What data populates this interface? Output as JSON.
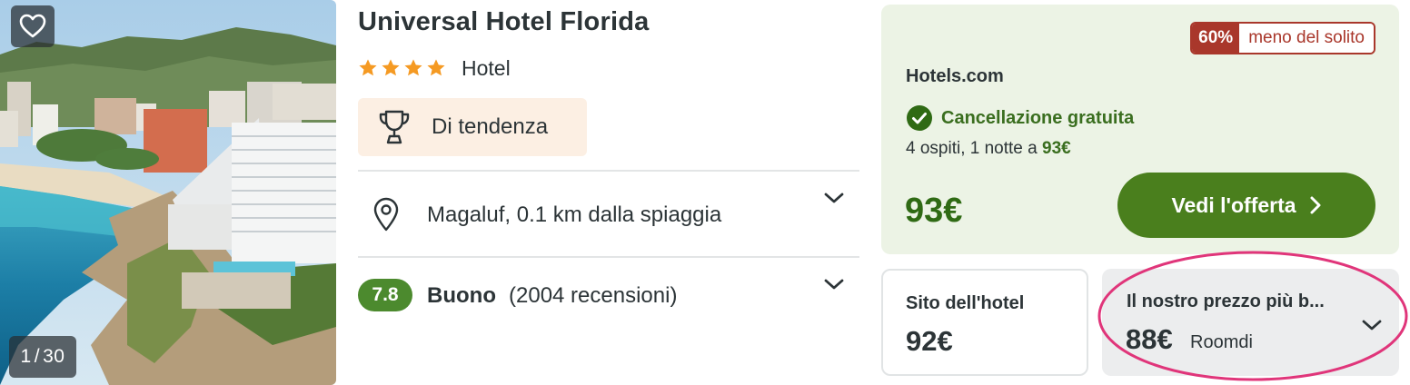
{
  "photo": {
    "counter_current": "1",
    "counter_separator": "/",
    "counter_total": "30",
    "favorite_icon": "heart-icon"
  },
  "hotel": {
    "name": "Universal Hotel Florida",
    "stars": 4,
    "type": "Hotel",
    "badge": "Di tendenza",
    "badge_icon": "trophy-icon",
    "location": "Magaluf, 0.1 km dalla spiaggia",
    "score": "7.8",
    "rating_word": "Buono",
    "review_count": "(2004 recensioni)"
  },
  "offer": {
    "discount_pct": "60%",
    "discount_text": "meno del solito",
    "provider": "Hotels.com",
    "cancellation": "Cancellazione gratuita",
    "guests_prefix": "4 ospiti, 1 notte a",
    "nightly_price": "93€",
    "price": "93€",
    "cta_label": "Vedi l'offerta"
  },
  "alternatives": {
    "hotel_site_label": "Sito dell'hotel",
    "hotel_site_price": "92€",
    "best_price_label": "Il nostro prezzo più b...",
    "best_price": "88€",
    "best_price_partner": "Roomdi"
  },
  "colors": {
    "accent_green": "#4a7f1d",
    "offer_bg": "#ecf3e5",
    "discount_red": "#a9372b",
    "star_orange": "#f59a23",
    "score_green": "#4c8a2e",
    "highlight_pink": "#e0357a"
  }
}
